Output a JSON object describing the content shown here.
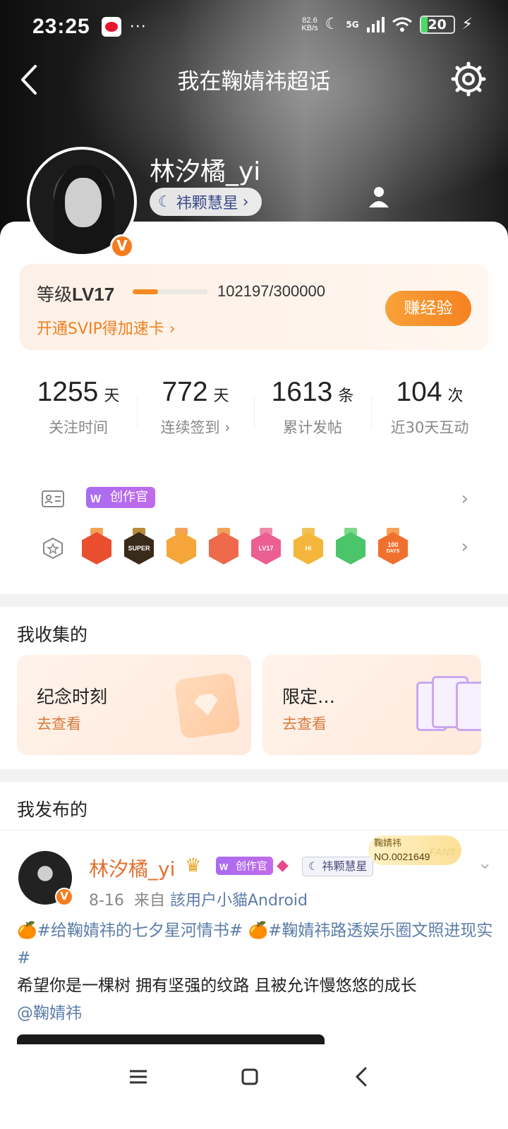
{
  "status": {
    "time": "23:25",
    "dots": "···",
    "speed_value": "82.6",
    "speed_unit": "KB/s",
    "network": "5G",
    "battery": "20",
    "battery_level_percent": 20
  },
  "nav": {
    "back_icon": "chevron-left-icon",
    "title": "我在鞠婧祎超话",
    "settings_icon": "gear-icon"
  },
  "profile": {
    "name": "林汐橘_yi",
    "level_title": "祎颗慧星",
    "verified_mark": "V"
  },
  "level": {
    "label": "等级",
    "value": "LV17",
    "exp": "102197/300000",
    "exp_fraction": 0.34,
    "svip_text": "开通SVIP得加速卡",
    "earn_button": "赚经验",
    "accent_color": "#f58220"
  },
  "stats": [
    {
      "value": "1255",
      "unit": "天",
      "label": "关注时间"
    },
    {
      "value": "772",
      "unit": "天",
      "label": "连续签到"
    },
    {
      "value": "1613",
      "unit": "条",
      "label": "累计发帖"
    },
    {
      "value": "104",
      "unit": "次",
      "label": "近30天互动"
    }
  ],
  "badges": {
    "creator_label": "创作官",
    "creator_logo": "W",
    "medals": [
      "",
      "SUPER",
      "",
      "",
      "LV17",
      "Hi",
      "",
      "100"
    ],
    "medal_days": "DAYS"
  },
  "collections": {
    "title": "我收集的",
    "items": [
      {
        "title": "纪念时刻",
        "subtitle": "去查看"
      },
      {
        "title": "限定…",
        "subtitle": "去查看"
      }
    ]
  },
  "posts": {
    "title": "我发布的",
    "item": {
      "author": "林汐橘_yi",
      "creator_label": "创作官",
      "level_title": "祎颗慧星",
      "fans_badge_name": "鞠婧祎",
      "fans_badge_no": "NO.0021649",
      "fans_badge_mark": "FANS",
      "date": "8-16",
      "source_prefix": "来自",
      "source": "該用户小貓Android",
      "tag1": "#给鞠婧祎的七夕星河情书#",
      "tag2": "#鞠婧祎路透娱乐圈文照进现实#",
      "text": "希望你是一棵树 拥有坚强的纹路 且被允许慢悠悠的成长",
      "mention": "@鞠婧祎"
    }
  },
  "system_nav": {
    "menu_icon": "menu-icon",
    "home_icon": "home-square-icon",
    "back_icon": "back-triangle-icon"
  }
}
